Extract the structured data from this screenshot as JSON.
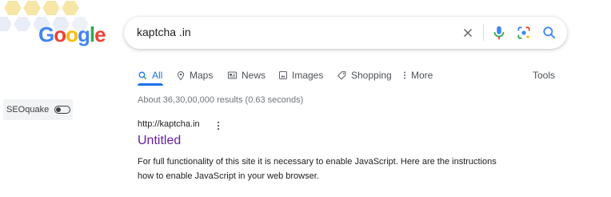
{
  "logo": {
    "letters": [
      "G",
      "o",
      "o",
      "g",
      "l",
      "e"
    ],
    "colors": [
      "#4285f4",
      "#ea4335",
      "#fbbc05",
      "#4285f4",
      "#34a853",
      "#ea4335"
    ]
  },
  "search": {
    "query": "kaptcha .in"
  },
  "icons": {
    "clear": "close-icon",
    "mic": "mic-icon",
    "lens": "camera-lens-icon",
    "search": "search-icon"
  },
  "tabs": [
    {
      "label": "All",
      "icon": "search-icon",
      "active": true
    },
    {
      "label": "Maps",
      "icon": "map-pin-icon"
    },
    {
      "label": "News",
      "icon": "newspaper-icon"
    },
    {
      "label": "Images",
      "icon": "image-icon"
    },
    {
      "label": "Shopping",
      "icon": "tag-icon"
    },
    {
      "label": "More",
      "icon": "more-vert-icon"
    }
  ],
  "tools_label": "Tools",
  "seoquake": {
    "label": "SEOquake"
  },
  "stats": "About 36,30,00,000 results (0.63 seconds)",
  "result": {
    "url": "http://kaptcha.in",
    "title": "Untitled",
    "snippet_line1": "For full functionality of this site it is necessary to enable JavaScript. Here are the instructions",
    "snippet_line2": "how to enable JavaScript in your web browser."
  },
  "colors": {
    "accent": "#1a73e8",
    "visited_link": "#681da8"
  }
}
